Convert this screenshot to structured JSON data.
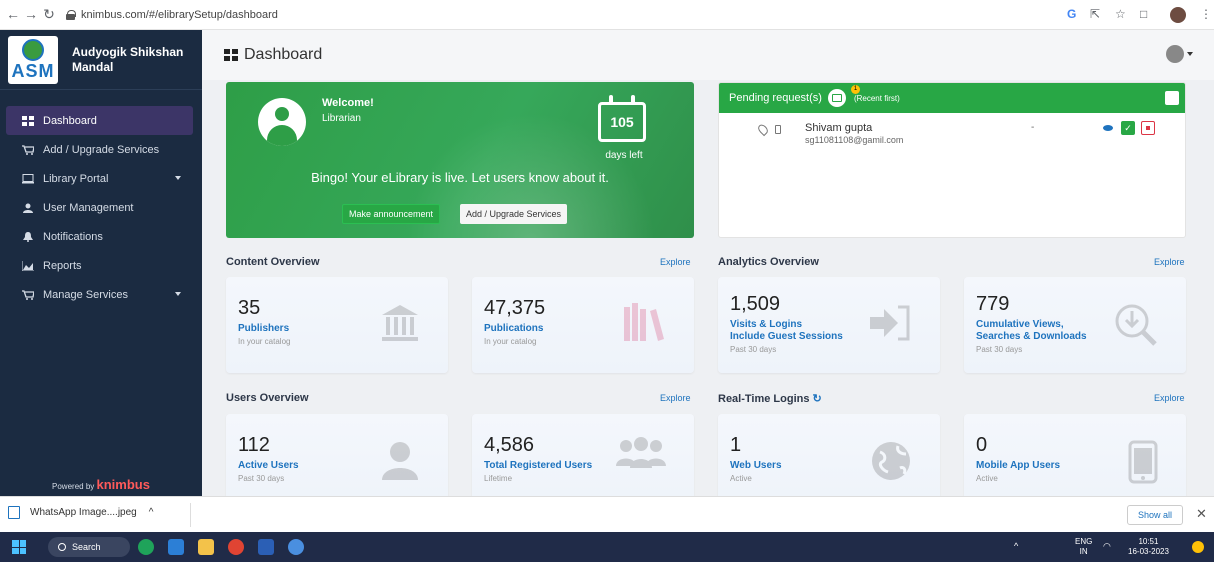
{
  "browser": {
    "url": "knimbus.com/#/elibrarySetup/dashboard",
    "back_icon": "arrow-left-icon",
    "forward_icon": "arrow-right-icon",
    "reload_icon": "reload-icon"
  },
  "sidebar": {
    "org_name": "Audyogik Shikshan Mandal",
    "logo_text": "ASM",
    "items": [
      {
        "label": "Dashboard",
        "icon": "dashboard-icon",
        "active": true
      },
      {
        "label": "Add / Upgrade Services",
        "icon": "cart-icon"
      },
      {
        "label": "Library Portal",
        "icon": "monitor-icon",
        "expandable": true
      },
      {
        "label": "User Management",
        "icon": "users-icon"
      },
      {
        "label": "Notifications",
        "icon": "bell-icon"
      },
      {
        "label": "Reports",
        "icon": "chart-icon"
      },
      {
        "label": "Manage Services",
        "icon": "cart-icon",
        "expandable": true
      }
    ],
    "powered_by": "Powered by",
    "powered_brand": "knimbus"
  },
  "header": {
    "title": "Dashboard"
  },
  "welcome": {
    "title": "Welcome!",
    "role": "Librarian",
    "days_count": "105",
    "days_label": "days left",
    "message": "Bingo! Your eLibrary is live. Let users know about it.",
    "announce_button": "Make announcement",
    "upgrade_button": "Add / Upgrade Services"
  },
  "pending": {
    "title": "Pending request(s)",
    "badge": "1",
    "subtitle": "(Recent first)",
    "rows": [
      {
        "name": "Shivam gupta",
        "email": "sg11081108@gamil.com",
        "status": "-"
      }
    ]
  },
  "content_overview": {
    "title": "Content Overview",
    "explore": "Explore",
    "cards": [
      {
        "value": "35",
        "label": "Publishers",
        "sub": "In your catalog",
        "icon": "bank-icon"
      },
      {
        "value": "47,375",
        "label": "Publications",
        "sub": "In your catalog",
        "icon": "books-icon"
      }
    ]
  },
  "analytics_overview": {
    "title": "Analytics Overview",
    "explore": "Explore",
    "cards": [
      {
        "value": "1,509",
        "label1": "Visits & Logins",
        "label2": "Include Guest Sessions",
        "sub": "Past 30 days",
        "icon": "login-icon"
      },
      {
        "value": "779",
        "label1": "Cumulative Views,",
        "label2": "Searches & Downloads",
        "sub": "Past 30 days",
        "icon": "download-search-icon"
      }
    ]
  },
  "users_overview": {
    "title": "Users Overview",
    "explore": "Explore",
    "cards": [
      {
        "value": "112",
        "label": "Active Users",
        "sub": "Past 30 days",
        "icon": "user-icon"
      },
      {
        "value": "4,586",
        "label": "Total Registered Users",
        "sub": "Lifetime",
        "icon": "group-icon"
      }
    ]
  },
  "realtime": {
    "title": "Real-Time Logins",
    "explore": "Explore",
    "cards": [
      {
        "value": "1",
        "label": "Web Users",
        "sub": "Active",
        "icon": "globe-icon"
      },
      {
        "value": "0",
        "label": "Mobile App Users",
        "sub": "Active",
        "icon": "mobile-icon"
      }
    ]
  },
  "downloads": {
    "file": "WhatsApp Image....jpeg",
    "show_all": "Show all"
  },
  "taskbar": {
    "search": "Search",
    "lang1": "ENG",
    "lang2": "IN",
    "time": "10:51",
    "date": "16-03-2023"
  }
}
